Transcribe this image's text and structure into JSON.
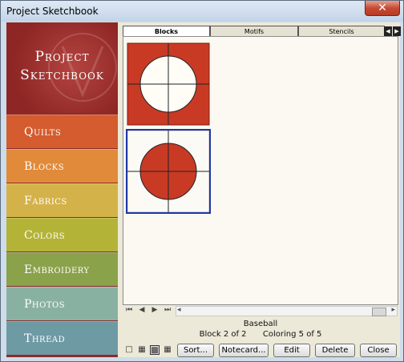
{
  "window": {
    "title": "Project Sketchbook",
    "close_glyph": "✕"
  },
  "logo": {
    "line1": "Project",
    "line2": "Sketchbook"
  },
  "sidebar": {
    "items": [
      {
        "label": "Quilts",
        "color": "#d45c2f"
      },
      {
        "label": "Blocks",
        "color": "#e08a3a"
      },
      {
        "label": "Fabrics",
        "color": "#d4b24a"
      },
      {
        "label": "Colors",
        "color": "#b3b337"
      },
      {
        "label": "Embroidery",
        "color": "#8aa24a"
      },
      {
        "label": "Photos",
        "color": "#89b1a2"
      },
      {
        "label": "Thread",
        "color": "#6e9aa4"
      }
    ]
  },
  "tabs": [
    {
      "label": "Blocks",
      "active": true
    },
    {
      "label": "Motifs",
      "active": false
    },
    {
      "label": "Stencils",
      "active": false
    }
  ],
  "tab_nav": {
    "prev": "◀",
    "next": "▶"
  },
  "gallery": {
    "items": [
      {
        "selected": false,
        "bg_color": "#c93a25",
        "circle_color": "#fffdf6"
      },
      {
        "selected": true,
        "bg_color": "#fbfaf5",
        "circle_color": "#c93a25"
      }
    ]
  },
  "pager": {
    "first": "⏮",
    "prev": "◀",
    "next": "▶",
    "last": "⏭",
    "scroll_left": "◂",
    "scroll_right": "▸"
  },
  "status": {
    "block_name": "Baseball",
    "block_position": "Block 2 of 2",
    "coloring": "Coloring 5 of 5"
  },
  "view_icons": [
    "□",
    "▦",
    "▩",
    "▦"
  ],
  "buttons": {
    "sort": "Sort...",
    "notecard": "Notecard...",
    "edit": "Edit",
    "delete": "Delete",
    "close": "Close"
  },
  "colors": {
    "selection_border": "#1f37a8",
    "block_red": "#c93a25"
  }
}
